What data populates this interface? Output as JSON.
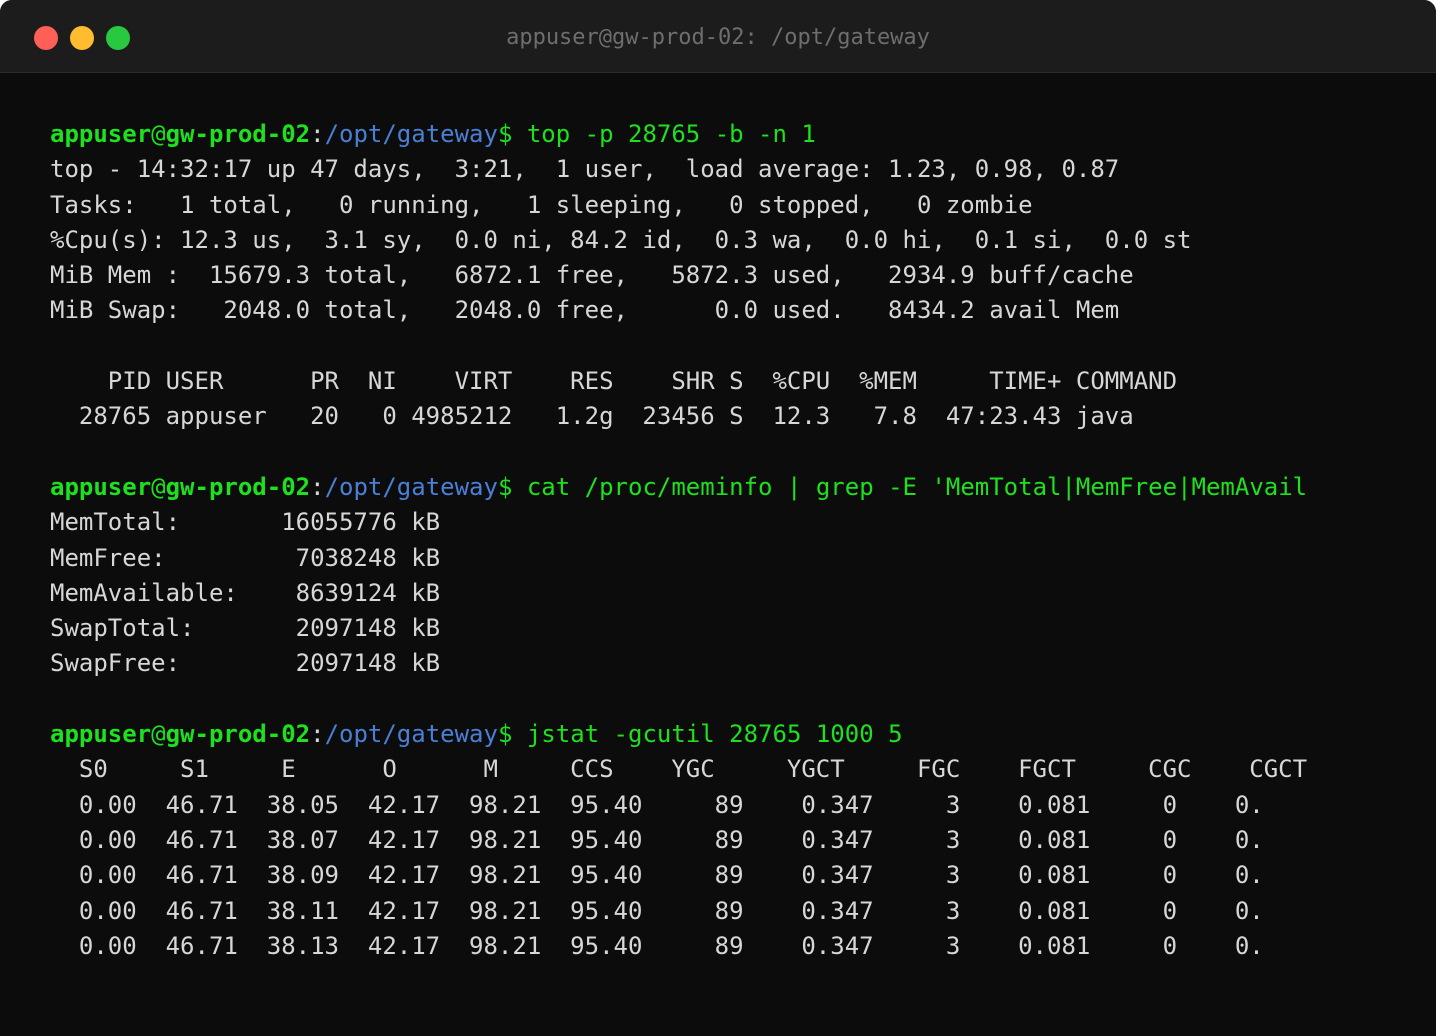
{
  "window": {
    "title": "appuser@gw-prod-02: /opt/gateway"
  },
  "prompt": {
    "user": "appuser",
    "at": "@",
    "host": "gw-prod-02",
    "colon": ":",
    "path": "/opt/gateway",
    "dollar": "$"
  },
  "blocks": [
    {
      "command": " top -p 28765 -b -n 1",
      "output": [
        "top - 14:32:17 up 47 days,  3:21,  1 user,  load average: 1.23, 0.98, 0.87",
        "Tasks:   1 total,   0 running,   1 sleeping,   0 stopped,   0 zombie",
        "%Cpu(s): 12.3 us,  3.1 sy,  0.0 ni, 84.2 id,  0.3 wa,  0.0 hi,  0.1 si,  0.0 st",
        "MiB Mem :  15679.3 total,   6872.1 free,   5872.3 used,   2934.9 buff/cache",
        "MiB Swap:   2048.0 total,   2048.0 free,      0.0 used.   8434.2 avail Mem",
        "",
        "    PID USER      PR  NI    VIRT    RES    SHR S  %CPU  %MEM     TIME+ COMMAND",
        "  28765 appuser   20   0 4985212   1.2g  23456 S  12.3   7.8  47:23.43 java"
      ]
    },
    {
      "command": " cat /proc/meminfo | grep -E 'MemTotal|MemFree|MemAvail",
      "output": [
        "MemTotal:       16055776 kB",
        "MemFree:         7038248 kB",
        "MemAvailable:    8639124 kB",
        "SwapTotal:       2097148 kB",
        "SwapFree:        2097148 kB"
      ]
    },
    {
      "command": " jstat -gcutil 28765 1000 5",
      "output": [
        "  S0     S1     E      O      M     CCS    YGC     YGCT     FGC    FGCT     CGC    CGCT",
        "  0.00  46.71  38.05  42.17  98.21  95.40     89    0.347     3    0.081     0    0.",
        "  0.00  46.71  38.07  42.17  98.21  95.40     89    0.347     3    0.081     0    0.",
        "  0.00  46.71  38.09  42.17  98.21  95.40     89    0.347     3    0.081     0    0.",
        "  0.00  46.71  38.11  42.17  98.21  95.40     89    0.347     3    0.081     0    0.",
        "  0.00  46.71  38.13  42.17  98.21  95.40     89    0.347     3    0.081     0    0."
      ]
    }
  ]
}
